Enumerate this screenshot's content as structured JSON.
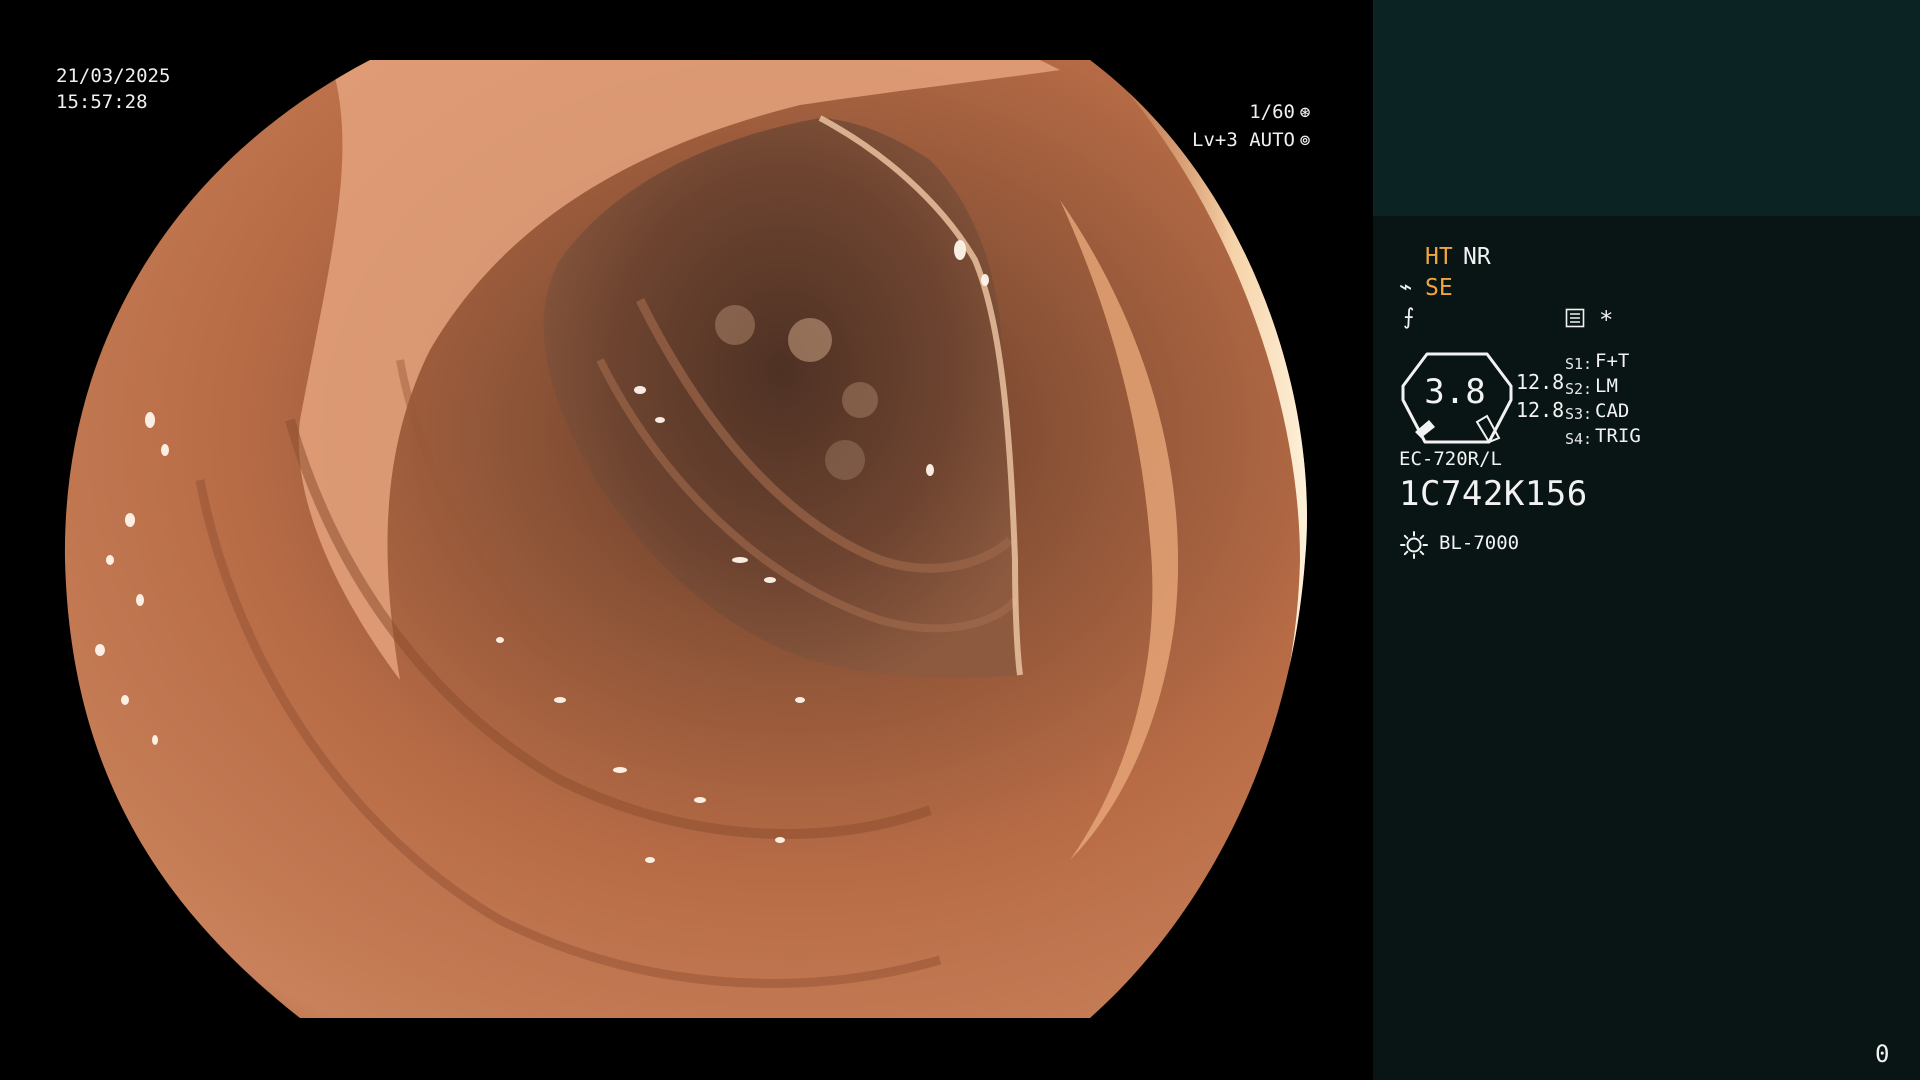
{
  "osd": {
    "date": "21/03/2025",
    "time": "15:57:28",
    "shutter": "1/60",
    "shutter_icon": "shutter-icon",
    "level": "Lv+3",
    "iris_mode": "AUTO",
    "iris_icon": "iris-icon"
  },
  "panel": {
    "ht": "HT",
    "nr": "NR",
    "se": "SE",
    "se_icon_glyph": "⌁",
    "fn_icon_glyph": "⨍",
    "asterisk": "*",
    "gauge_value": "3.8",
    "gauge_num_1": "12.8",
    "gauge_num_2": "12.8",
    "switches": [
      {
        "label": "S1:",
        "value": "F+T"
      },
      {
        "label": "S2:",
        "value": "LM"
      },
      {
        "label": "S3:",
        "value": "CAD"
      },
      {
        "label": "S4:",
        "value": "TRIG"
      }
    ],
    "model": "EC-720R/L",
    "serial": "1C742K156",
    "lamp": "BL-7000",
    "corner_number": "0"
  },
  "colors": {
    "accent_orange": "#f0a640",
    "panel_bg": "#081514",
    "panel_header_bg": "#0c2324",
    "tissue": "#c2744c"
  }
}
